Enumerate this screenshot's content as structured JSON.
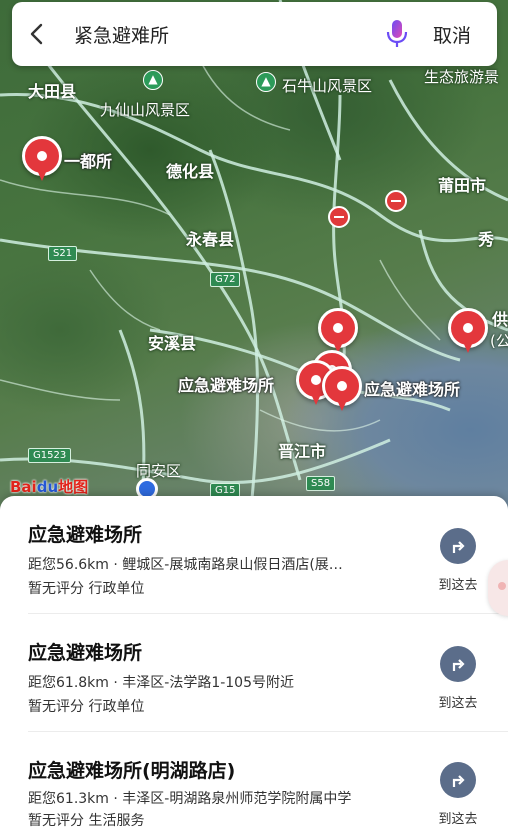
{
  "search": {
    "query": "紧急避难所",
    "cancel_label": "取消"
  },
  "map": {
    "place_labels": {
      "datian": "大田县",
      "jiuxianshan": "九仙山风景区",
      "shiniushan": "石牛山风景区",
      "shengtai": "生态旅游景",
      "dehua": "德化县",
      "putian": "莆田市",
      "yongchun": "永春县",
      "anxi": "安溪县",
      "jinjiang": "晋江市",
      "tongan": "同安区",
      "xiu": "秀",
      "gong": "供",
      "gong_paren": "(公"
    },
    "road_badges": {
      "s21": "S21",
      "g72": "G72",
      "g1523": "G1523",
      "g15": "G15",
      "s58": "S58"
    },
    "pin_labels": {
      "yidusuo": "一都所",
      "shelter_left": "应急避难场所",
      "shelter_right": "应急避难场所"
    },
    "logo": {
      "bai": "Bai",
      "du": "du",
      "ditu": "地图"
    },
    "accent_pin_color": "#e3373c"
  },
  "results": [
    {
      "title": "应急避难场所",
      "detail": "距您56.6km · 鲤城区-展城南路泉山假日酒店(展…",
      "meta": "暂无评分  行政单位",
      "route_label": "到这去"
    },
    {
      "title": "应急避难场所",
      "detail": "距您61.8km · 丰泽区-法学路1-105号附近",
      "meta": "暂无评分  行政单位",
      "route_label": "到这去"
    },
    {
      "title": "应急避难场所(明湖路店)",
      "detail": "距您61.3km · 丰泽区-明湖路泉州师范学院附属中学",
      "meta": "暂无评分  生活服务",
      "route_label": "到这去"
    }
  ]
}
